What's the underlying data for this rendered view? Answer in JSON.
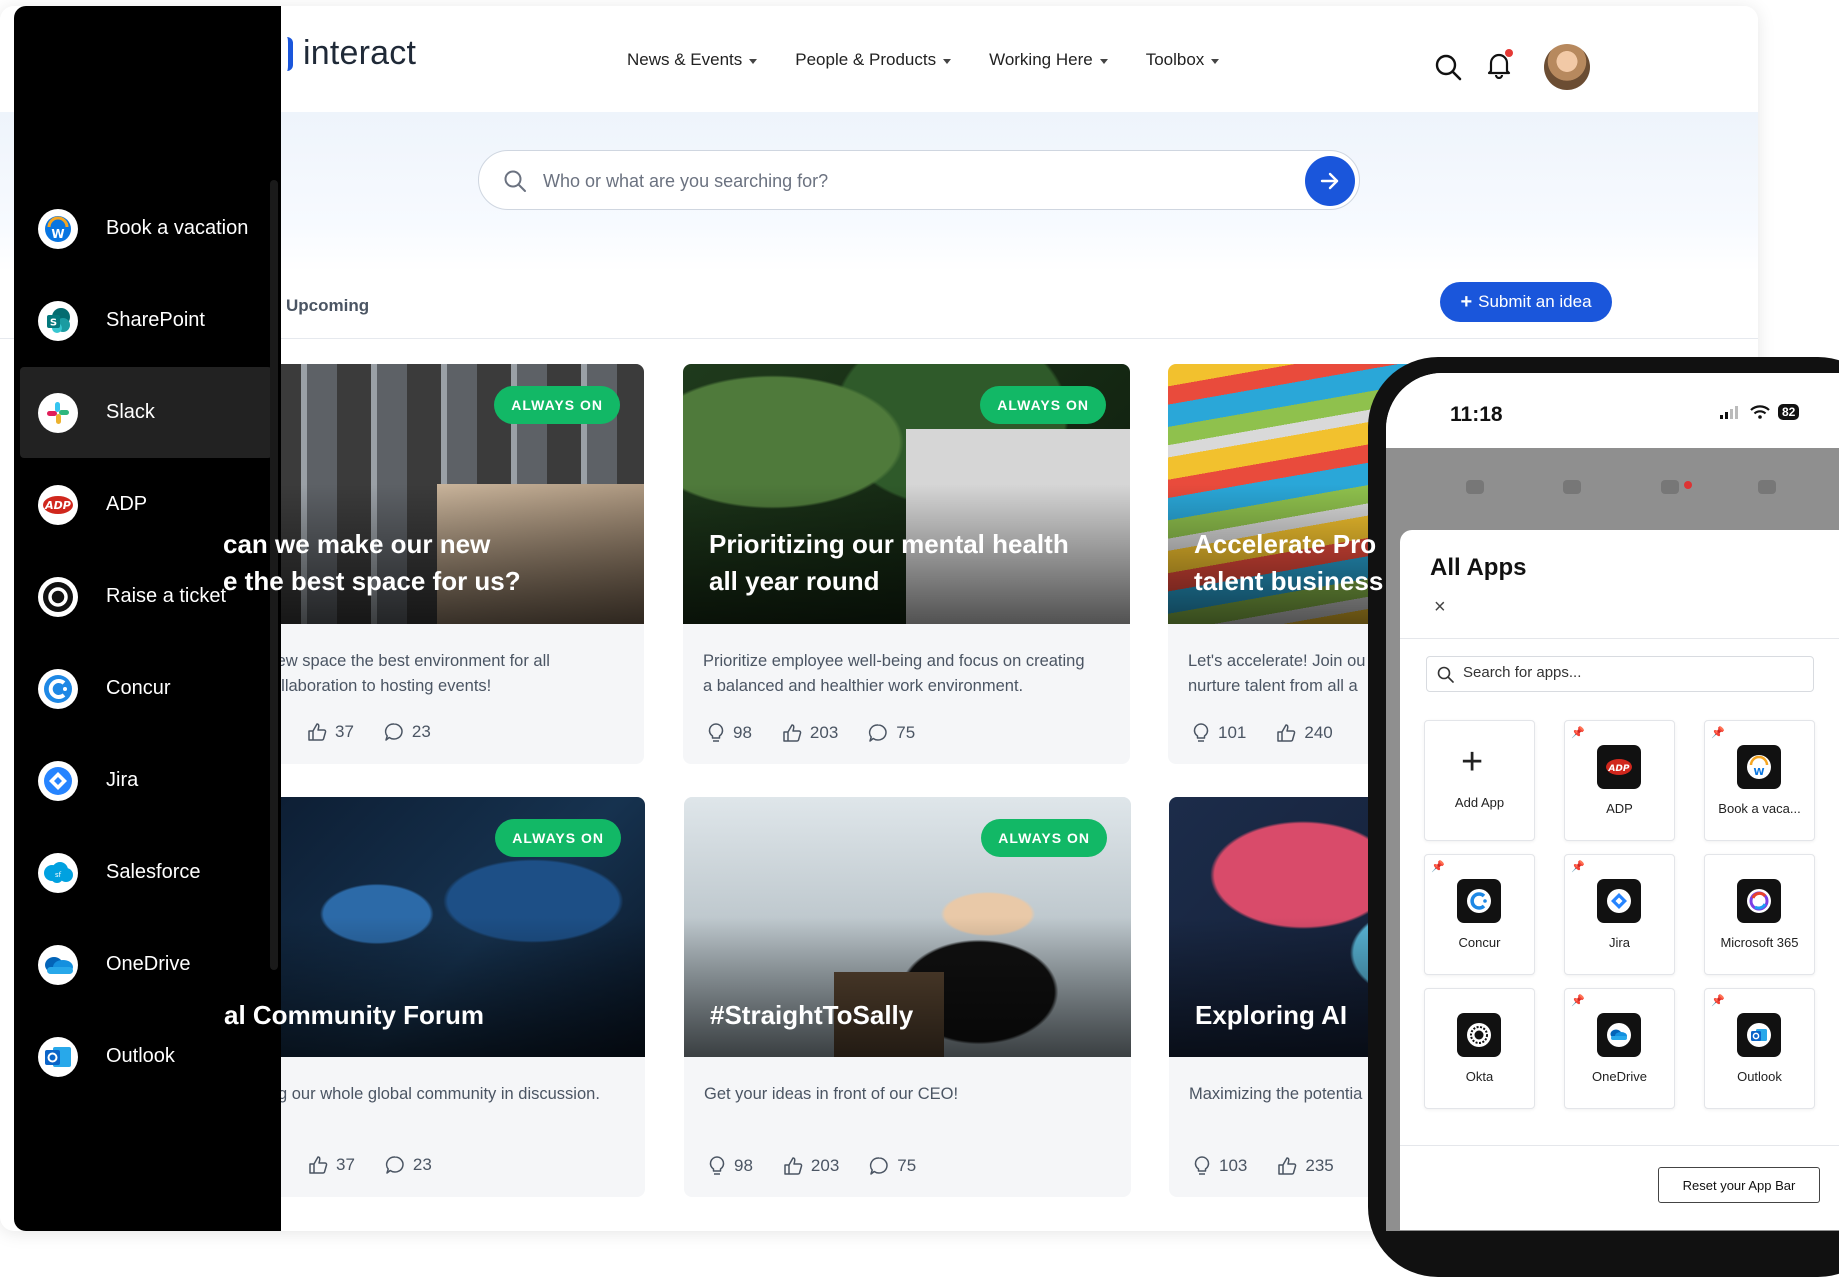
{
  "header": {
    "logo_text": "interact",
    "nav": [
      "News & Events",
      "People & Products",
      "Working Here",
      "Toolbox"
    ]
  },
  "search": {
    "placeholder": "Who or what are you searching for?"
  },
  "tabs": {
    "upcoming": "Upcoming"
  },
  "submit_idea": "Submit an idea",
  "badge_text": "ALWAYS ON",
  "cards": [
    {
      "title": "can we make our new\ne the best space for us?",
      "desc": "ke our new space the best environment for all\n, from collaboration to hosting events!",
      "likes": "37",
      "comments": "23"
    },
    {
      "title": "Prioritizing our mental health\nall year round",
      "desc": "Prioritize employee well-being and focus on creating\na balanced and healthier work environment.",
      "ideas": "98",
      "likes": "203",
      "comments": "75"
    },
    {
      "title": "Accelerate Pro\ntalent business",
      "desc": "Let's accelerate! Join ou\nnurture talent from all a",
      "ideas": "101",
      "likes": "240"
    },
    {
      "title": "al Community Forum",
      "desc": "g our whole global community in discussion.",
      "likes": "37",
      "comments": "23"
    },
    {
      "title": "#StraightToSally",
      "desc": "Get your ideas in front of our CEO!",
      "ideas": "98",
      "likes": "203",
      "comments": "75"
    },
    {
      "title": "Exploring AI",
      "desc": "Maximizing the potentia",
      "ideas": "103",
      "likes": "235"
    }
  ],
  "appbar": {
    "items": [
      {
        "label": "Book a vacation",
        "icon": "workday-icon",
        "color": "#f5a623"
      },
      {
        "label": "SharePoint",
        "icon": "sharepoint-icon",
        "color": "#038387"
      },
      {
        "label": "Slack",
        "icon": "slack-icon",
        "color": "#4a154b"
      },
      {
        "label": "ADP",
        "icon": "adp-icon",
        "color": "#d0271d"
      },
      {
        "label": "Raise a ticket",
        "icon": "ticket-icon",
        "color": "#111111"
      },
      {
        "label": "Concur",
        "icon": "concur-icon",
        "color": "#1e88e5"
      },
      {
        "label": "Jira",
        "icon": "jira-icon",
        "color": "#2684ff"
      },
      {
        "label": "Salesforce",
        "icon": "salesforce-icon",
        "color": "#00a1e0"
      },
      {
        "label": "OneDrive",
        "icon": "onedrive-icon",
        "color": "#0078d4"
      },
      {
        "label": "Outlook",
        "icon": "outlook-icon",
        "color": "#0a64c8"
      }
    ]
  },
  "phone": {
    "time": "11:18",
    "battery": "82",
    "all_apps": {
      "title": "All Apps",
      "close": "×",
      "search_placeholder": "Search for apps...",
      "tiles": [
        {
          "label": "Add App",
          "icon": "plus-icon"
        },
        {
          "label": "ADP",
          "icon": "adp-icon"
        },
        {
          "label": "Book a vaca...",
          "icon": "workday-icon"
        },
        {
          "label": "Concur",
          "icon": "concur-icon"
        },
        {
          "label": "Jira",
          "icon": "jira-icon"
        },
        {
          "label": "Microsoft 365",
          "icon": "microsoft-365-icon"
        },
        {
          "label": "Okta",
          "icon": "okta-icon"
        },
        {
          "label": "OneDrive",
          "icon": "onedrive-icon"
        },
        {
          "label": "Outlook",
          "icon": "outlook-icon"
        }
      ],
      "reset": "Reset your App Bar"
    }
  }
}
